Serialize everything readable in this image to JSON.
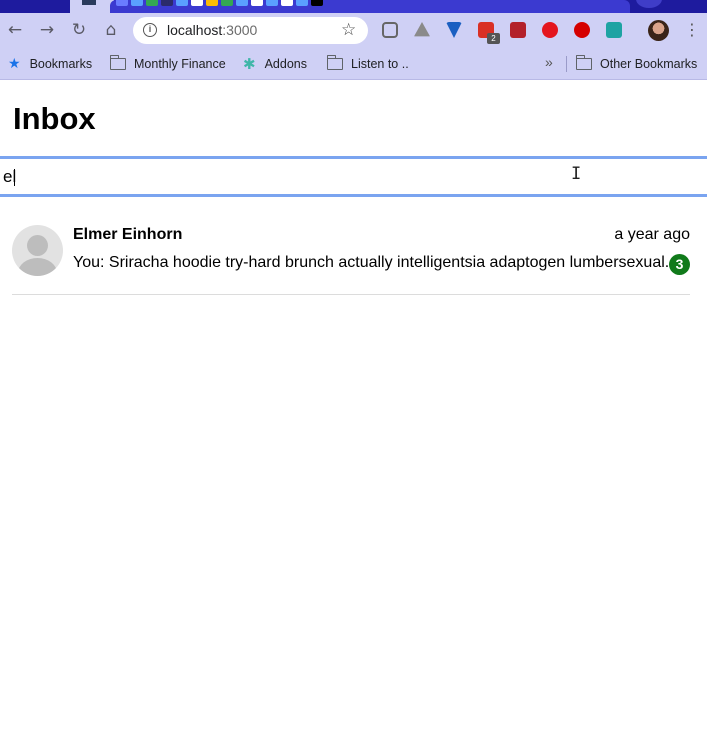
{
  "browser": {
    "url_host": "localhost",
    "url_port": ":3000",
    "extension_badge": "2",
    "bookmarks": [
      {
        "label": "Bookmarks",
        "icon": "star-icon"
      },
      {
        "label": "Monthly Finance",
        "icon": "folder-icon"
      },
      {
        "label": "Addons",
        "icon": "puzzle-icon"
      },
      {
        "label": "Listen to ..",
        "icon": "folder-icon"
      }
    ],
    "overflow_label": "»",
    "other_bookmarks": "Other Bookmarks"
  },
  "page": {
    "title": "Inbox",
    "search": {
      "value": "el",
      "placeholder": ""
    }
  },
  "conversations": [
    {
      "name": "Elmer Einhorn",
      "time": "a year ago",
      "message": "You: Sriracha hoodie try-hard brunch actually intelligentsia adaptogen lumbersexual.",
      "unread_count": "3"
    }
  ],
  "colors": {
    "browser_frame": "#cfd0f5",
    "tab_strip": "#1e1b9e",
    "search_focus": "#7aa4f0",
    "unread_badge": "#107a1a"
  }
}
